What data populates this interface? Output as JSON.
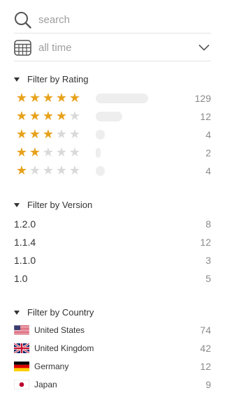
{
  "search": {
    "placeholder": "search",
    "icon": "search-icon"
  },
  "range": {
    "value": "all time",
    "icon": "calendar-grid-icon"
  },
  "rating": {
    "title": "Filter by Rating",
    "rows": [
      {
        "stars": 5,
        "count": "129",
        "share": 0.6
      },
      {
        "stars": 4,
        "count": "12",
        "share": 0.3
      },
      {
        "stars": 3,
        "count": "4",
        "share": 0.1
      },
      {
        "stars": 2,
        "count": "2",
        "share": 0.04
      },
      {
        "stars": 1,
        "count": "4",
        "share": 0.1
      }
    ]
  },
  "version": {
    "title": "Filter by Version",
    "rows": [
      {
        "label": "1.2.0",
        "count": "8"
      },
      {
        "label": "1.1.4",
        "count": "12"
      },
      {
        "label": "1.1.0",
        "count": "3"
      },
      {
        "label": "1.0",
        "count": "5"
      }
    ]
  },
  "country": {
    "title": "Filter by Country",
    "rows": [
      {
        "label": "United States",
        "count": "74",
        "flag": "us-flag-icon"
      },
      {
        "label": "United Kingdom",
        "count": "42",
        "flag": "uk-flag-icon"
      },
      {
        "label": "Germany",
        "count": "12",
        "flag": "germany-flag-icon"
      },
      {
        "label": "Japan",
        "count": "9",
        "flag": "japan-flag-icon"
      }
    ]
  },
  "colors": {
    "star_on": "#e7a21c",
    "star_off": "#d9d9d9",
    "bar": "#eeeeee"
  }
}
